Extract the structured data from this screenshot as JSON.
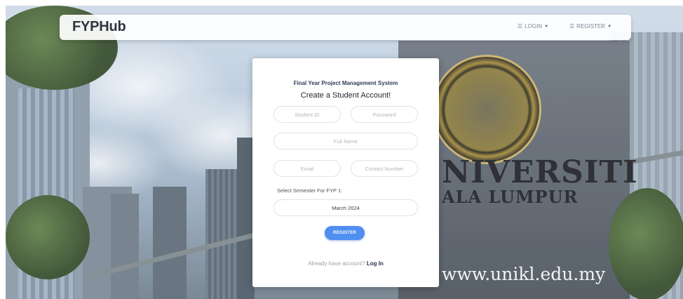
{
  "navbar": {
    "brand": "FYPHub",
    "login_label": "LOGIN",
    "register_label": "REGISTER"
  },
  "card": {
    "subtitle": "Final Year Project Management System",
    "title": "Create a Student Account!",
    "fields": {
      "student_id_placeholder": "Student ID",
      "password_placeholder": "Password",
      "full_name_placeholder": "Full Name",
      "email_placeholder": "Email",
      "contact_placeholder": "Contact Number"
    },
    "semester_label": "Select Semester For FYP 1:",
    "semester_selected": "March 2024",
    "register_button": "REGISTER",
    "login_prompt": "Already have account?",
    "login_link": "Log In"
  },
  "background": {
    "sign_text_line1": "NIVERSITI",
    "sign_text_line2": "ALA LUMPUR",
    "website": "www.unikl.edu.my"
  },
  "icons": {
    "login": "list-icon",
    "register": "list-icon",
    "dropdown": "chevron-down-icon"
  },
  "colors": {
    "accent": "#4e8ff0",
    "brand_text": "#2d3540"
  }
}
